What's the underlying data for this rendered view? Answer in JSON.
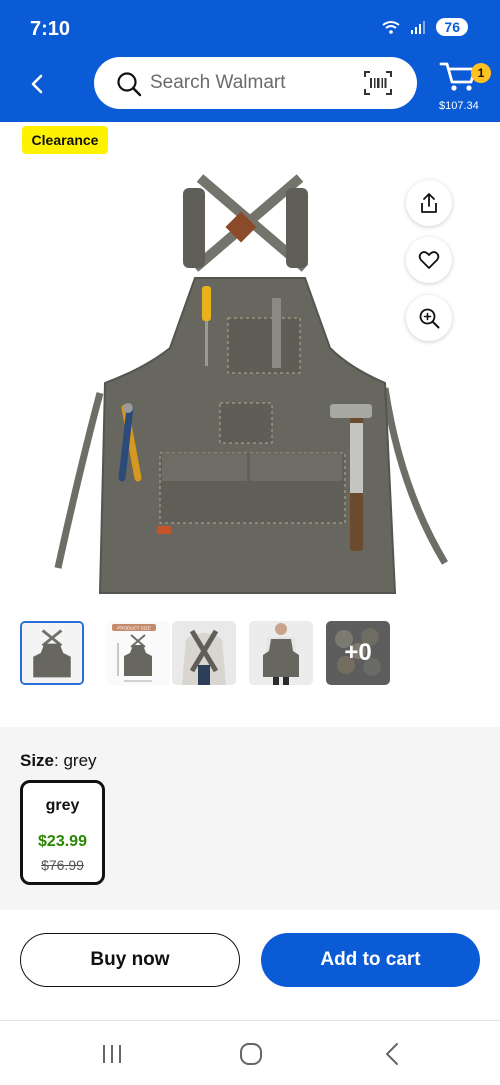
{
  "status_bar": {
    "time": "7:10",
    "battery": "76"
  },
  "search": {
    "placeholder": "Search Walmart"
  },
  "cart": {
    "count": "1",
    "total": "$107.34"
  },
  "product": {
    "badge": "Clearance",
    "image_icon": "apron-product-image",
    "action_icons": [
      "share-icon",
      "heart-icon",
      "zoom-icon"
    ],
    "thumbnails": [
      {
        "name": "thumbnail-1",
        "selected": true
      },
      {
        "name": "thumbnail-2-product-size",
        "label": "PRODUCT SIZE"
      },
      {
        "name": "thumbnail-3",
        "selected": false
      },
      {
        "name": "thumbnail-4",
        "selected": false
      },
      {
        "name": "thumbnail-5-more",
        "more": "+0"
      }
    ]
  },
  "size": {
    "label": "Size",
    "selected_value": ": grey",
    "option": {
      "name": "grey",
      "price": "$23.99",
      "was_price": "$76.99"
    }
  },
  "actions": {
    "buy_now": "Buy now",
    "add_to_cart": "Add to cart"
  },
  "colors": {
    "brand_blue": "#0a5bd5",
    "spark_yellow": "#ffc220",
    "price_green": "#2a8703"
  }
}
